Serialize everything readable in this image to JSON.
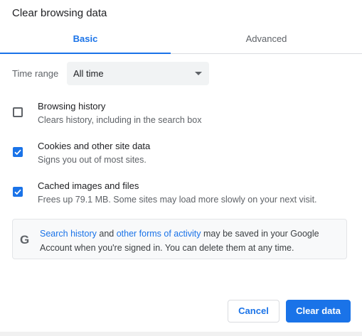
{
  "dialog": {
    "title": "Clear browsing data"
  },
  "tabs": [
    {
      "label": "Basic",
      "selected": true
    },
    {
      "label": "Advanced",
      "selected": false
    }
  ],
  "time_range": {
    "label": "Time range",
    "value": "All time"
  },
  "options": [
    {
      "label": "Browsing history",
      "description": "Clears history, including in the search box",
      "checked": false
    },
    {
      "label": "Cookies and other site data",
      "description": "Signs you out of most sites.",
      "checked": true
    },
    {
      "label": "Cached images and files",
      "description": "Frees up 79.1 MB. Some sites may load more slowly on your next visit.",
      "checked": true
    }
  ],
  "notice": {
    "icon": "google-g-icon",
    "icon_glyph": "G",
    "link1": "Search history",
    "mid": " and ",
    "link2": "other forms of activity",
    "rest": " may be saved in your Google Account when you're signed in. You can delete them at any time."
  },
  "buttons": {
    "cancel": "Cancel",
    "clear": "Clear data"
  },
  "colors": {
    "accent": "#1a73e8",
    "text": "#202124",
    "secondary": "#5f6368"
  }
}
